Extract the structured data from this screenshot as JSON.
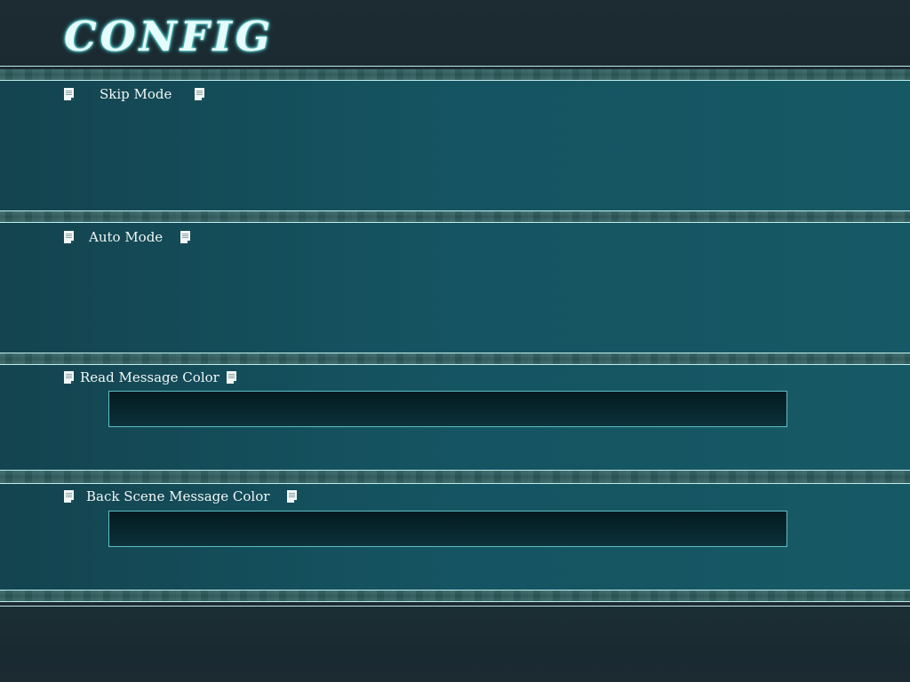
{
  "screen": {
    "title": "CONFIG"
  },
  "sections": [
    {
      "label": "Skip Mode",
      "icon": "document-icon"
    },
    {
      "label": "Auto Mode",
      "icon": "document-icon"
    },
    {
      "label": "Read Message Color",
      "icon": "document-icon"
    },
    {
      "label": "Back Scene Message Color",
      "icon": "document-icon"
    }
  ],
  "colors": {
    "panel": "#155361",
    "title_glow": "#6fe6e6",
    "rule": "#bfecec",
    "color_box_border": "#5fbfc3"
  }
}
